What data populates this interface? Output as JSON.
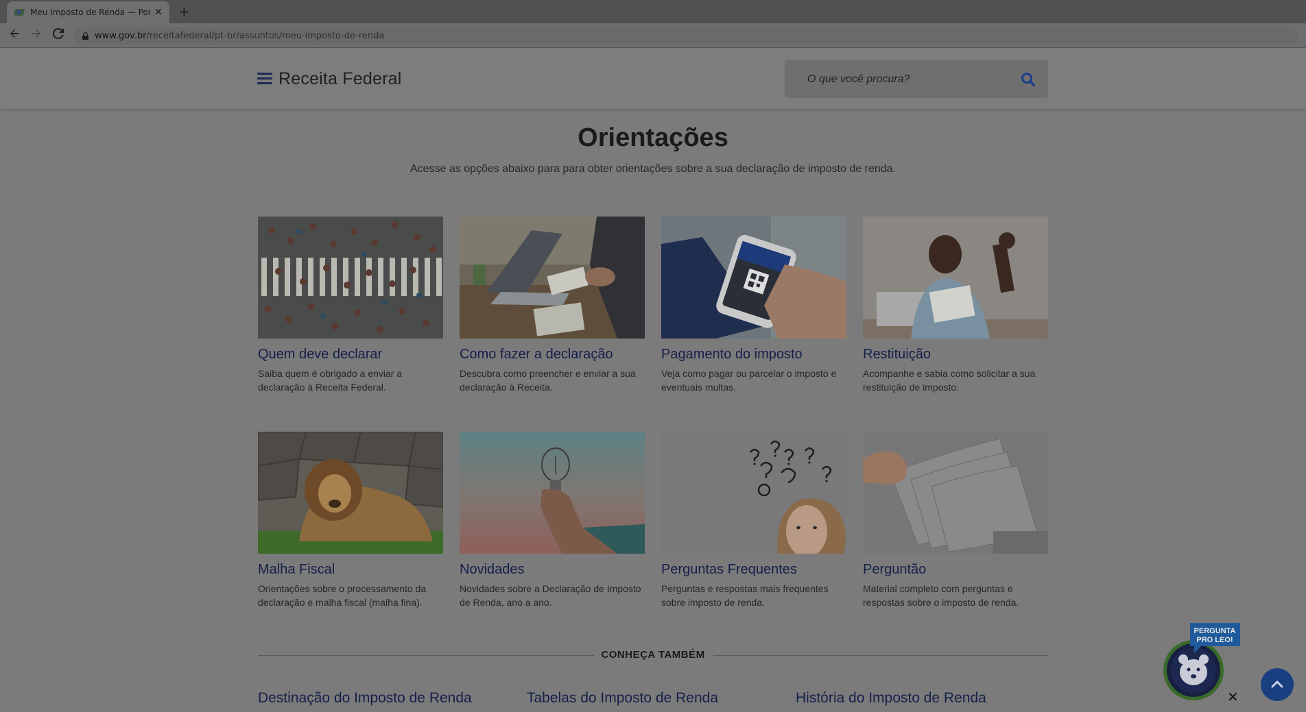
{
  "browser": {
    "tab_title": "Meu Imposto de Renda — Portu",
    "tab_close": "✕",
    "new_tab": "+",
    "url_host": "www.gov.br",
    "url_path": "/receitafederal/pt-br/assuntos/meu-imposto-de-renda"
  },
  "header": {
    "brand": "Receita Federal",
    "search_placeholder": "O que você procura?"
  },
  "main": {
    "title": "Orientações",
    "subtitle": "Acesse as opções abaixo para para obter orientações sobre a sua declaração de imposto de renda.",
    "cards": [
      {
        "title": "Quem deve declarar",
        "description": "Saiba quem é obrigado a enviar a declaração à Receita Federal.",
        "image": "crowd-crosswalk"
      },
      {
        "title": "Como fazer a declaração",
        "description": "Descubra como preencher e enviar a sua declaração à Receita.",
        "image": "laptop-desk"
      },
      {
        "title": "Pagamento do imposto",
        "description": "Veja como pagar ou parcelar o imposto e eventuais multas.",
        "image": "phone-qr-payment"
      },
      {
        "title": "Restituição",
        "description": "Acompanhe e sabia como solicitar a sua restituição de imposto.",
        "image": "happy-man-letter"
      },
      {
        "title": "Malha Fiscal",
        "description": "Orientações sobre o processamento da declaração e malha fiscal (malha fina).",
        "image": "lion"
      },
      {
        "title": "Novidades",
        "description": "Novidades sobre a Declaração de Imposto de Renda, ano a ano.",
        "image": "hand-lightbulb"
      },
      {
        "title": "Perguntas Frequentes",
        "description": "Perguntas e respostas mais frequentes sobre imposto de renda.",
        "image": "woman-question-marks"
      },
      {
        "title": "Perguntão",
        "description": "Material completo com perguntas e respostas sobre o imposto de renda.",
        "image": "book-pages"
      }
    ]
  },
  "also": {
    "label": "CONHEÇA TAMBÉM",
    "links": [
      "Destinação do Imposto de Renda",
      "Tabelas do Imposto de Renda",
      "História do Imposto de Renda"
    ]
  },
  "widgets": {
    "leo_badge_line1": "PERGUNTA",
    "leo_badge_line2": "PRO LEO!",
    "leo_close": "✕"
  }
}
